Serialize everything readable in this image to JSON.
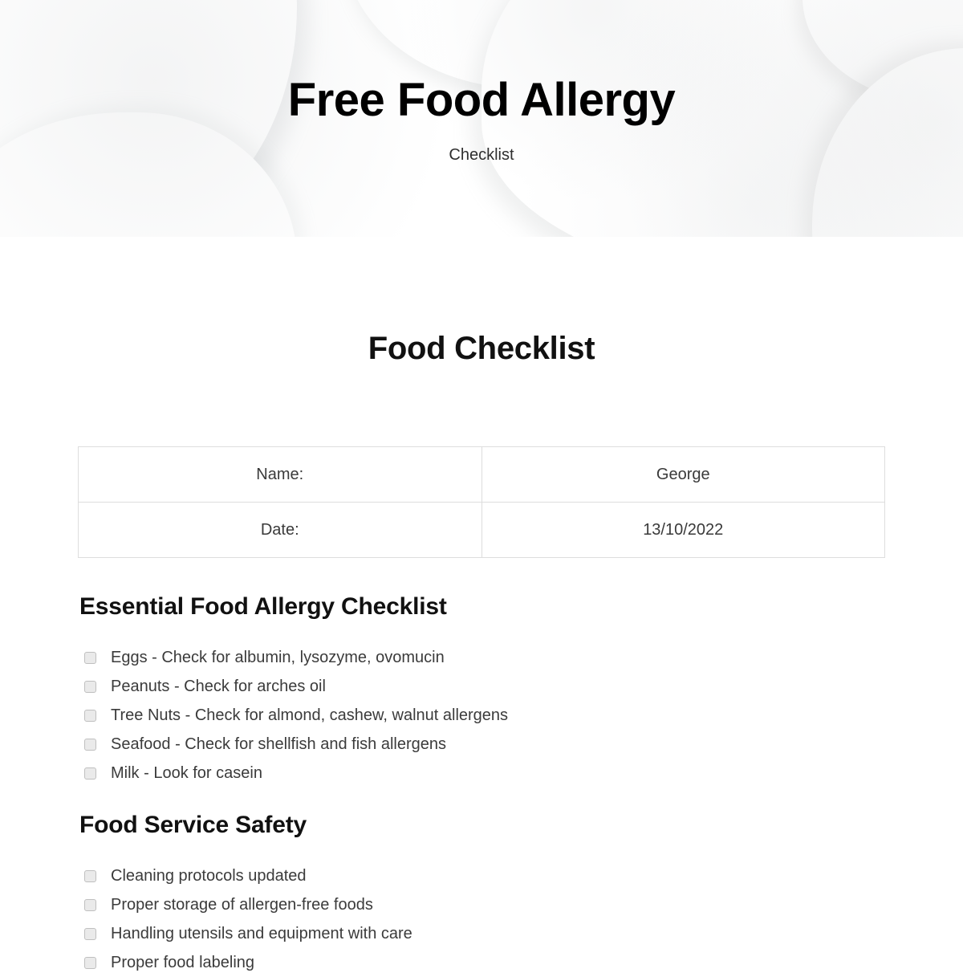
{
  "banner": {
    "title": "Free Food Allergy",
    "subtitle": "Checklist"
  },
  "document": {
    "title": "Food Checklist"
  },
  "info_table": {
    "rows": [
      {
        "label": "Name:",
        "value": "George"
      },
      {
        "label": "Date:",
        "value": "13/10/2022"
      }
    ]
  },
  "sections": [
    {
      "heading": "Essential Food Allergy Checklist",
      "items": [
        {
          "label": "Eggs - Check for albumin, lysozyme, ovomucin",
          "checked": false
        },
        {
          "label": "Peanuts - Check for arches oil",
          "checked": false
        },
        {
          "label": "Tree Nuts - Check for almond, cashew, walnut allergens",
          "checked": false
        },
        {
          "label": "Seafood - Check for shellfish and fish allergens",
          "checked": false
        },
        {
          "label": "Milk - Look for casein",
          "checked": false
        }
      ]
    },
    {
      "heading": "Food Service Safety",
      "items": [
        {
          "label": "Cleaning protocols updated",
          "checked": false
        },
        {
          "label": "Proper storage of allergen-free foods",
          "checked": false
        },
        {
          "label": "Handling utensils and equipment with care",
          "checked": false
        },
        {
          "label": "Proper food labeling",
          "checked": false
        }
      ]
    }
  ],
  "colors": {
    "page_background": "#ffffff",
    "heading_text": "#111111",
    "body_text": "#3b3b3b",
    "table_border": "#dddddd",
    "checkbox_fill": "#eaeaea",
    "checkbox_border": "#bfbfbf"
  }
}
